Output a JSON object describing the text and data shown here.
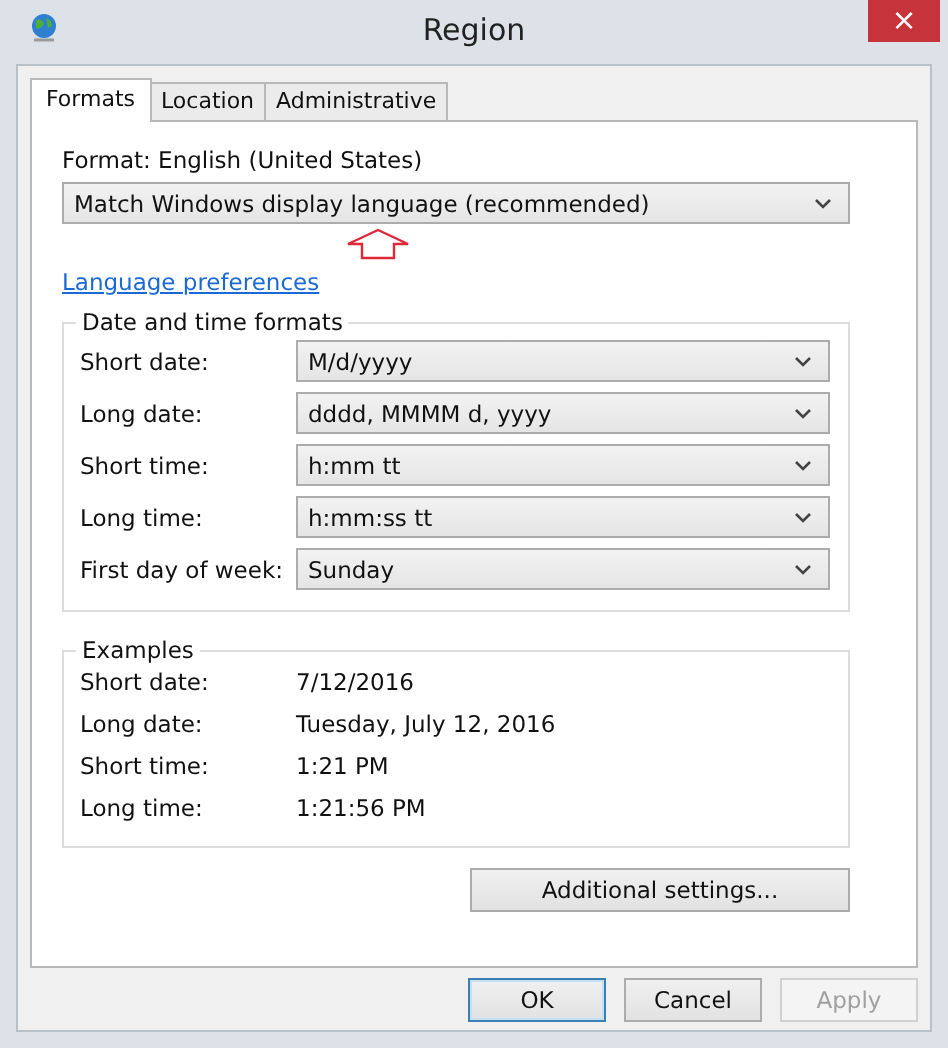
{
  "window": {
    "title": "Region",
    "close": "×"
  },
  "tabs": [
    {
      "label": "Formats",
      "selected": true
    },
    {
      "label": "Location",
      "selected": false
    },
    {
      "label": "Administrative",
      "selected": false
    }
  ],
  "format": {
    "label": "Format: English (United States)",
    "value": "Match Windows display language (recommended)"
  },
  "language_link": "Language preferences",
  "date_time_formats": {
    "title": "Date and time formats",
    "rows": [
      {
        "label": "Short date:",
        "value": "M/d/yyyy"
      },
      {
        "label": "Long date:",
        "value": "dddd, MMMM d, yyyy"
      },
      {
        "label": "Short time:",
        "value": "h:mm tt"
      },
      {
        "label": "Long time:",
        "value": "h:mm:ss tt"
      },
      {
        "label": "First day of week:",
        "value": "Sunday"
      }
    ]
  },
  "examples": {
    "title": "Examples",
    "rows": [
      {
        "label": "Short date:",
        "value": "7/12/2016"
      },
      {
        "label": "Long date:",
        "value": "Tuesday, July 12, 2016"
      },
      {
        "label": "Short time:",
        "value": "1:21 PM"
      },
      {
        "label": "Long time:",
        "value": "1:21:56 PM"
      }
    ]
  },
  "additional_button": "Additional settings...",
  "buttons": [
    {
      "label": "OK",
      "default": true,
      "disabled": false
    },
    {
      "label": "Cancel",
      "default": false,
      "disabled": false
    },
    {
      "label": "Apply",
      "default": false,
      "disabled": true
    }
  ]
}
